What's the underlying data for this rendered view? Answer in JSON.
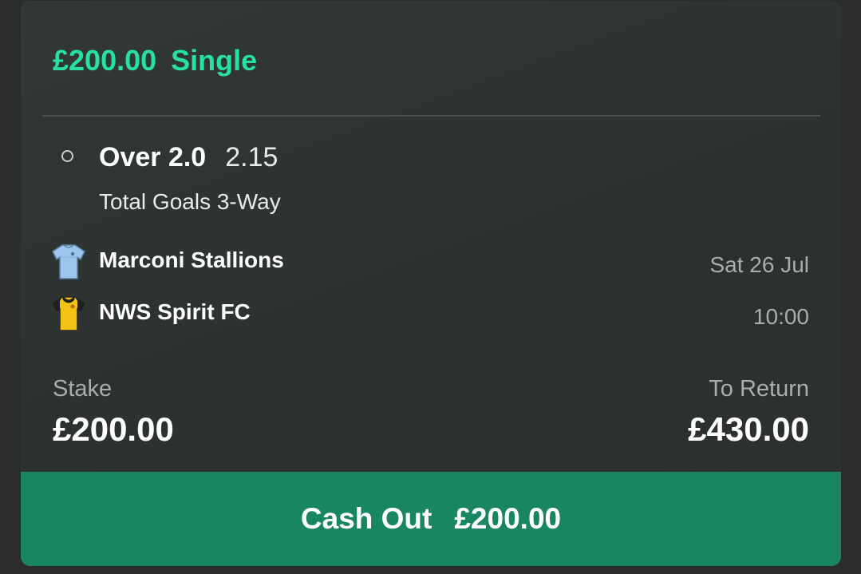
{
  "bet": {
    "stake_amount": "£200.00",
    "type": "Single"
  },
  "selection": {
    "name": "Over 2.0",
    "odds": "2.15",
    "market": "Total Goals 3-Way"
  },
  "match": {
    "home_team": "Marconi Stallions",
    "home_shirt_icon": "light-blue-shirt-icon",
    "away_team": "NWS Spirit FC",
    "away_shirt_icon": "yellow-black-shirt-icon",
    "date": "Sat 26 Jul",
    "time": "10:00"
  },
  "summary": {
    "stake_label": "Stake",
    "stake_value": "£200.00",
    "return_label": "To Return",
    "return_value": "£430.00"
  },
  "cashout": {
    "label": "Cash Out",
    "amount": "£200.00"
  },
  "colors": {
    "accent": "#27e0a3",
    "cashout_bg": "#188563",
    "card_bg": "#313836",
    "muted_text": "#a9adab"
  }
}
